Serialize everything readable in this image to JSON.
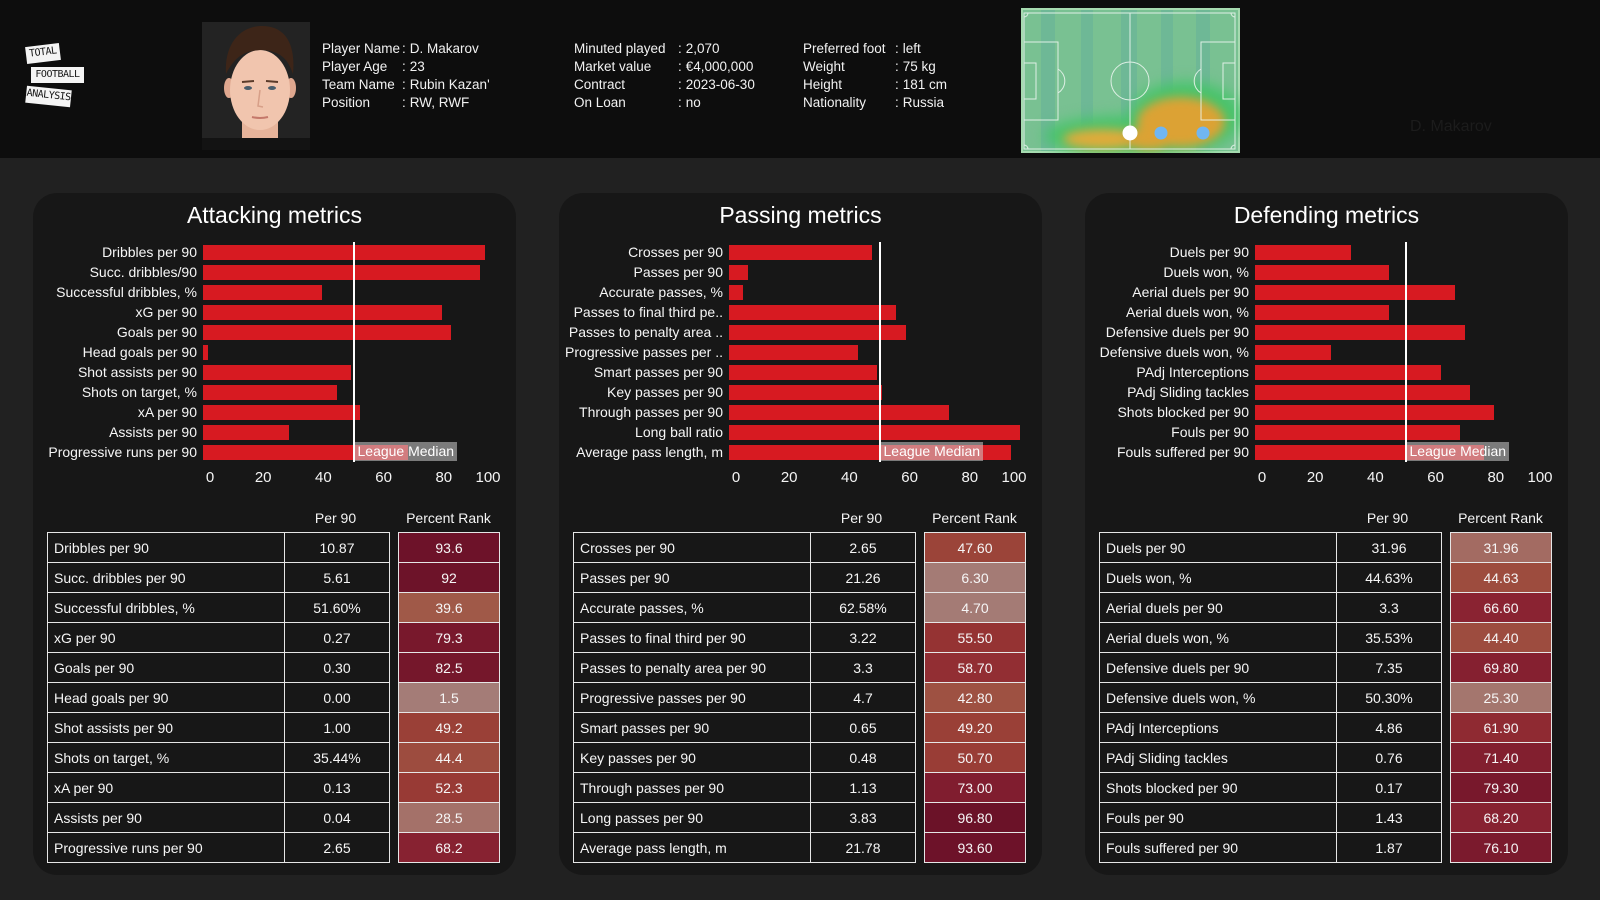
{
  "header": {
    "logo": {
      "lines": [
        "TOTAL",
        "FOOTBALL",
        "ANALYSIS"
      ]
    },
    "player_info": {
      "separator": ":",
      "columns": [
        [
          {
            "label": "Player Name",
            "value": "D. Makarov"
          },
          {
            "label": "Player Age",
            "value": "23"
          },
          {
            "label": "Team Name",
            "value": "Rubin Kazan'"
          },
          {
            "label": "Position",
            "value": "RW, RWF"
          }
        ],
        [
          {
            "label": "Minuted played",
            "value": "2,070"
          },
          {
            "label": "Market value",
            "value": "€4,000,000"
          },
          {
            "label": "Contract",
            "value": "2023-06-30"
          },
          {
            "label": "On Loan",
            "value": "no"
          }
        ],
        [
          {
            "label": "Preferred foot",
            "value": "left"
          },
          {
            "label": "Weight",
            "value": "75 kg"
          },
          {
            "label": "Height",
            "value": "181 cm"
          },
          {
            "label": "Nationality",
            "value": "Russia"
          }
        ]
      ]
    },
    "heatmap": {
      "caption": "D. Makarov"
    }
  },
  "theme": {
    "bar_color": "#d71a21",
    "median_line_color": "#ffffff",
    "rank_color_scale": [
      {
        "at": 0,
        "color": "#a47c77"
      },
      {
        "at": 25,
        "color": "#a4776f"
      },
      {
        "at": 32,
        "color": "#a36b62"
      },
      {
        "at": 40,
        "color": "#a05847"
      },
      {
        "at": 48,
        "color": "#9b4338"
      },
      {
        "at": 56,
        "color": "#953233"
      },
      {
        "at": 66,
        "color": "#8b2432"
      },
      {
        "at": 76,
        "color": "#7b1a2d"
      },
      {
        "at": 90,
        "color": "#6e1329"
      },
      {
        "at": 100,
        "color": "#6a1128"
      }
    ]
  },
  "chart_data": [
    {
      "type": "bar",
      "orientation": "horizontal",
      "title": "Attacking metrics",
      "categories": [
        "Dribbles per 90",
        "Succ. dribbles/90",
        "Successful dribbles, %",
        "xG per 90",
        "Goals per 90",
        "Head goals per 90",
        "Shot assists per 90",
        "Shots on target, %",
        "xA per 90",
        "Assists per 90",
        "Progressive runs per 90"
      ],
      "values": [
        93.6,
        92,
        39.6,
        79.3,
        82.5,
        1.5,
        49.2,
        44.4,
        52.3,
        28.5,
        68.2
      ],
      "xlabel": "",
      "ylabel": "",
      "xlim": [
        0,
        100
      ],
      "xticks": [
        0,
        20,
        40,
        60,
        80,
        100
      ],
      "grid": false,
      "legend": "none",
      "reference_line": {
        "value": 50,
        "label": "League Median"
      }
    },
    {
      "type": "bar",
      "orientation": "horizontal",
      "title": "Passing metrics",
      "categories": [
        "Crosses per 90",
        "Passes per 90",
        "Accurate passes, %",
        "Passes to final third pe..",
        "Passes to penalty area ..",
        "Progressive passes per ..",
        "Smart passes per 90",
        "Key passes per 90",
        "Through passes per 90",
        "Long ball ratio",
        "Average pass length, m"
      ],
      "values": [
        47.6,
        6.3,
        4.7,
        55.5,
        58.7,
        42.8,
        49.2,
        50.7,
        73.0,
        96.8,
        93.6
      ],
      "xlabel": "",
      "ylabel": "",
      "xlim": [
        0,
        100
      ],
      "xticks": [
        0,
        20,
        40,
        60,
        80,
        100
      ],
      "grid": false,
      "legend": "none",
      "reference_line": {
        "value": 50,
        "label": "League Median"
      }
    },
    {
      "type": "bar",
      "orientation": "horizontal",
      "title": "Defending metrics",
      "categories": [
        "Duels per 90",
        "Duels won, %",
        "Aerial duels per 90",
        "Aerial duels won, %",
        "Defensive duels per 90",
        "Defensive duels won, %",
        "PAdj Interceptions",
        "PAdj Sliding tackles",
        "Shots blocked per 90",
        "Fouls per 90",
        "Fouls suffered per 90"
      ],
      "values": [
        31.96,
        44.63,
        66.6,
        44.4,
        69.8,
        25.3,
        61.9,
        71.4,
        79.3,
        68.2,
        76.1
      ],
      "xlabel": "",
      "ylabel": "",
      "xlim": [
        0,
        100
      ],
      "xticks": [
        0,
        20,
        40,
        60,
        80,
        100
      ],
      "grid": false,
      "legend": "none",
      "reference_line": {
        "value": 50,
        "label": "League Median"
      }
    }
  ],
  "tables": [
    {
      "headers": {
        "metric": "",
        "per90": "Per 90",
        "percent_rank": "Percent Rank"
      },
      "rows": [
        {
          "metric": "Dribbles per 90",
          "per90": "10.87",
          "percent_rank": "93.6"
        },
        {
          "metric": "Succ. dribbles per 90",
          "per90": "5.61",
          "percent_rank": "92"
        },
        {
          "metric": "Successful dribbles, %",
          "per90": "51.60%",
          "percent_rank": "39.6"
        },
        {
          "metric": "xG per 90",
          "per90": "0.27",
          "percent_rank": "79.3"
        },
        {
          "metric": "Goals per 90",
          "per90": "0.30",
          "percent_rank": "82.5"
        },
        {
          "metric": "Head goals per 90",
          "per90": "0.00",
          "percent_rank": "1.5"
        },
        {
          "metric": "Shot assists per 90",
          "per90": "1.00",
          "percent_rank": "49.2"
        },
        {
          "metric": "Shots on target, %",
          "per90": "35.44%",
          "percent_rank": "44.4"
        },
        {
          "metric": "xA per 90",
          "per90": "0.13",
          "percent_rank": "52.3"
        },
        {
          "metric": "Assists per 90",
          "per90": "0.04",
          "percent_rank": "28.5"
        },
        {
          "metric": "Progressive runs per 90",
          "per90": "2.65",
          "percent_rank": "68.2"
        }
      ]
    },
    {
      "headers": {
        "metric": "",
        "per90": "Per 90",
        "percent_rank": "Percent Rank"
      },
      "rows": [
        {
          "metric": "Crosses per 90",
          "per90": "2.65",
          "percent_rank": "47.60"
        },
        {
          "metric": "Passes per 90",
          "per90": "21.26",
          "percent_rank": "6.30"
        },
        {
          "metric": "Accurate passes, %",
          "per90": "62.58%",
          "percent_rank": "4.70"
        },
        {
          "metric": "Passes to final third per 90",
          "per90": "3.22",
          "percent_rank": "55.50"
        },
        {
          "metric": "Passes to penalty area per 90",
          "per90": "3.3",
          "percent_rank": "58.70"
        },
        {
          "metric": "Progressive passes per 90",
          "per90": "4.7",
          "percent_rank": "42.80"
        },
        {
          "metric": "Smart passes per 90",
          "per90": "0.65",
          "percent_rank": "49.20"
        },
        {
          "metric": "Key passes per 90",
          "per90": "0.48",
          "percent_rank": "50.70"
        },
        {
          "metric": "Through passes per 90",
          "per90": "1.13",
          "percent_rank": "73.00"
        },
        {
          "metric": "Long passes per 90",
          "per90": "3.83",
          "percent_rank": "96.80"
        },
        {
          "metric": "Average pass length, m",
          "per90": "21.78",
          "percent_rank": "93.60"
        }
      ]
    },
    {
      "headers": {
        "metric": "",
        "per90": "Per 90",
        "percent_rank": "Percent Rank"
      },
      "rows": [
        {
          "metric": "Duels per 90",
          "per90": "31.96",
          "percent_rank": "31.96"
        },
        {
          "metric": "Duels won, %",
          "per90": "44.63%",
          "percent_rank": "44.63"
        },
        {
          "metric": "Aerial duels per 90",
          "per90": "3.3",
          "percent_rank": "66.60"
        },
        {
          "metric": "Aerial duels won, %",
          "per90": "35.53%",
          "percent_rank": "44.40"
        },
        {
          "metric": "Defensive duels per 90",
          "per90": "7.35",
          "percent_rank": "69.80"
        },
        {
          "metric": "Defensive duels won, %",
          "per90": "50.30%",
          "percent_rank": "25.30"
        },
        {
          "metric": "PAdj Interceptions",
          "per90": "4.86",
          "percent_rank": "61.90"
        },
        {
          "metric": "PAdj Sliding tackles",
          "per90": "0.76",
          "percent_rank": "71.40"
        },
        {
          "metric": "Shots blocked per 90",
          "per90": "0.17",
          "percent_rank": "79.30"
        },
        {
          "metric": "Fouls per 90",
          "per90": "1.43",
          "percent_rank": "68.20"
        },
        {
          "metric": "Fouls suffered per 90",
          "per90": "1.87",
          "percent_rank": "76.10"
        }
      ]
    }
  ]
}
